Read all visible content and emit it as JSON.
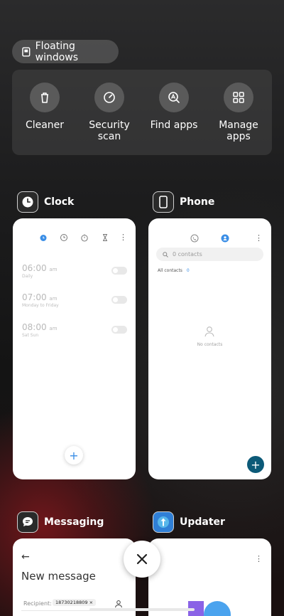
{
  "floating": {
    "label": "Floating windows"
  },
  "tools": [
    {
      "label": "Cleaner",
      "icon": "trash-icon"
    },
    {
      "label": "Security\nscan",
      "icon": "speedometer-icon"
    },
    {
      "label": "Find apps",
      "icon": "find-apps-icon"
    },
    {
      "label": "Manage\napps",
      "icon": "grid-icon"
    }
  ],
  "apps": {
    "clock": {
      "name": "Clock",
      "alarms": [
        {
          "time": "06:00",
          "ampm": "am",
          "sub": "Daily"
        },
        {
          "time": "07:00",
          "ampm": "am",
          "sub": "Monday to Friday"
        },
        {
          "time": "08:00",
          "ampm": "am",
          "sub": "Sat Sun"
        }
      ],
      "add": "+"
    },
    "phone": {
      "name": "Phone",
      "search_placeholder": "0 contacts",
      "all_contacts": "All contacts",
      "count": "0",
      "empty": "No contacts",
      "add": "+"
    },
    "messaging": {
      "name": "Messaging",
      "back": "←",
      "title": "New message",
      "recipient_label": "Recipient:",
      "recipient_value": "18730218809"
    },
    "updater": {
      "name": "Updater",
      "menu": "⋮"
    }
  },
  "colors": {
    "accent": "#3a8ee6",
    "fab_phone": "#0c5a78"
  }
}
